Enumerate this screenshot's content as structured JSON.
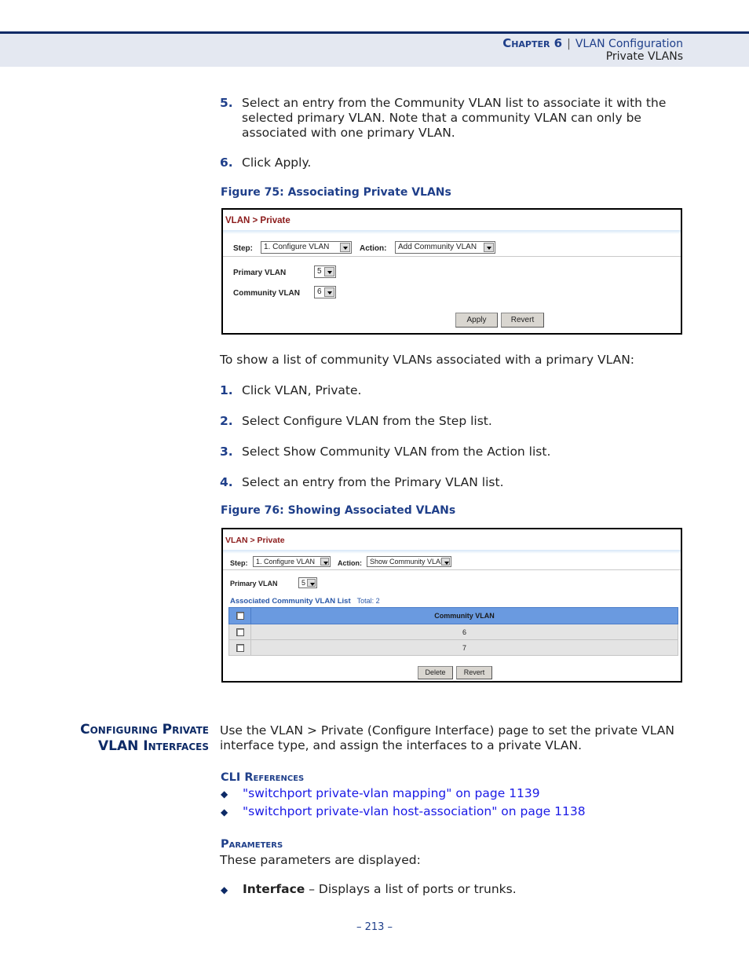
{
  "header": {
    "chapter_label": "Chapter 6",
    "separator": "|",
    "chapter_title": "VLAN Configuration",
    "section_title": "Private VLANs"
  },
  "steps_a": [
    {
      "num": "5.",
      "text": "Select an entry from the Community VLAN list to associate it with the selected primary VLAN. Note that a community VLAN can only be associated with one primary VLAN."
    },
    {
      "num": "6.",
      "text": "Click Apply."
    }
  ],
  "figure75": {
    "caption": "Figure 75:  Associating Private VLANs",
    "breadcrumb": "VLAN > Private",
    "step_label": "Step:",
    "step_value": "1. Configure VLAN",
    "action_label": "Action:",
    "action_value": "Add Community VLAN",
    "primary_label": "Primary VLAN",
    "primary_value": "5",
    "community_label": "Community VLAN",
    "community_value": "6",
    "apply_button": "Apply",
    "revert_button": "Revert"
  },
  "intro_b": "To show a list of community VLANs associated with a primary VLAN:",
  "steps_b": [
    {
      "num": "1.",
      "text": "Click VLAN, Private."
    },
    {
      "num": "2.",
      "text": "Select Configure VLAN from the Step list."
    },
    {
      "num": "3.",
      "text": "Select Show Community VLAN from the Action list."
    },
    {
      "num": "4.",
      "text": "Select an entry from the Primary VLAN list."
    }
  ],
  "figure76": {
    "caption": "Figure 76:  Showing Associated VLANs",
    "breadcrumb": "VLAN > Private",
    "step_label": "Step:",
    "step_value": "1. Configure VLAN",
    "action_label": "Action:",
    "action_value": "Show Community VLAN",
    "primary_label": "Primary VLAN",
    "primary_value": "5",
    "list_title": "Associated Community VLAN List",
    "list_total": "Total: 2",
    "column_header": "Community VLAN",
    "rows": [
      "6",
      "7"
    ],
    "delete_button": "Delete",
    "revert_button": "Revert"
  },
  "section": {
    "heading_line1": "Configuring Private",
    "heading_line2": "VLAN Interfaces",
    "intro": "Use the VLAN > Private (Configure Interface) page to set the private VLAN interface type, and assign the interfaces to a private VLAN.",
    "cli_heading": "CLI References",
    "cli_links": [
      "\"switchport private-vlan mapping\" on page 1139",
      "\"switchport private-vlan host-association\" on page 1138"
    ],
    "params_heading": "Parameters",
    "params_intro": "These parameters are displayed:",
    "params": [
      {
        "term": "Interface",
        "desc": " – Displays a list of ports or trunks."
      }
    ]
  },
  "footer": {
    "page_number": "–  213  –"
  }
}
